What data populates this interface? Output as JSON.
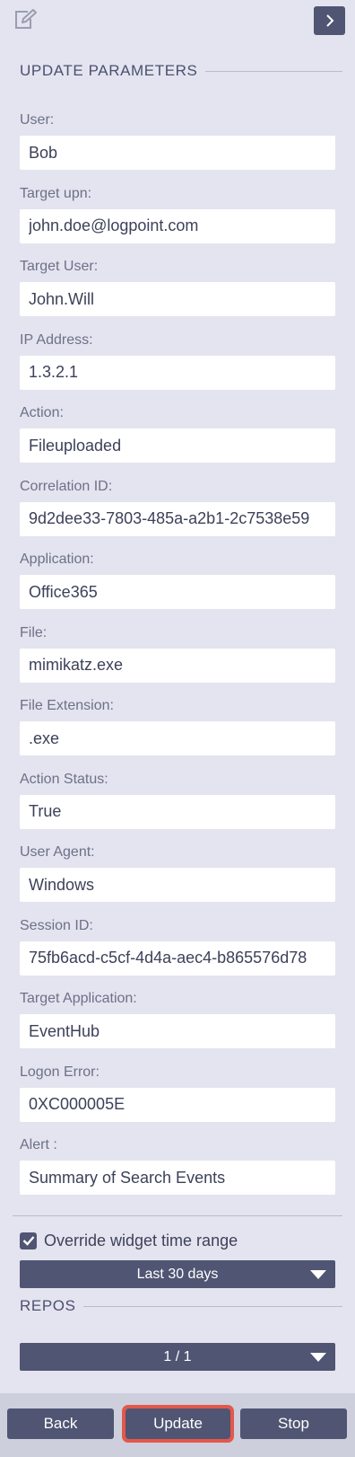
{
  "header": {
    "edit_icon": "edit-icon",
    "collapse_icon": "chevron-right-icon"
  },
  "section_title": "UPDATE PARAMETERS",
  "fields": [
    {
      "label": "User:",
      "value": "Bob"
    },
    {
      "label": "Target upn:",
      "value": "john.doe@logpoint.com"
    },
    {
      "label": "Target User:",
      "value": "John.Will"
    },
    {
      "label": "IP Address:",
      "value": "1.3.2.1"
    },
    {
      "label": "Action:",
      "value": "Fileuploaded"
    },
    {
      "label": "Correlation ID:",
      "value": "9d2dee33-7803-485a-a2b1-2c7538e59"
    },
    {
      "label": "Application:",
      "value": "Office365"
    },
    {
      "label": "File:",
      "value": "mimikatz.exe"
    },
    {
      "label": "File Extension:",
      "value": ".exe"
    },
    {
      "label": "Action Status:",
      "value": "True"
    },
    {
      "label": "User Agent:",
      "value": "Windows"
    },
    {
      "label": "Session ID:",
      "value": "75fb6acd-c5cf-4d4a-aec4-b865576d78"
    },
    {
      "label": "Target Application:",
      "value": "EventHub"
    },
    {
      "label": "Logon Error:",
      "value": "0XC000005E"
    },
    {
      "label": "Alert :",
      "value": "Summary of Search Events"
    }
  ],
  "override": {
    "label": "Override widget time range",
    "checked": true
  },
  "time_range": {
    "selected": "Last 30 days"
  },
  "repos": {
    "title": "REPOS",
    "selected": "1 / 1"
  },
  "footer": {
    "back_label": "Back",
    "update_label": "Update",
    "stop_label": "Stop"
  },
  "colors": {
    "accent": "#505573",
    "background": "#e3e4ef",
    "highlight": "#e4574b"
  }
}
